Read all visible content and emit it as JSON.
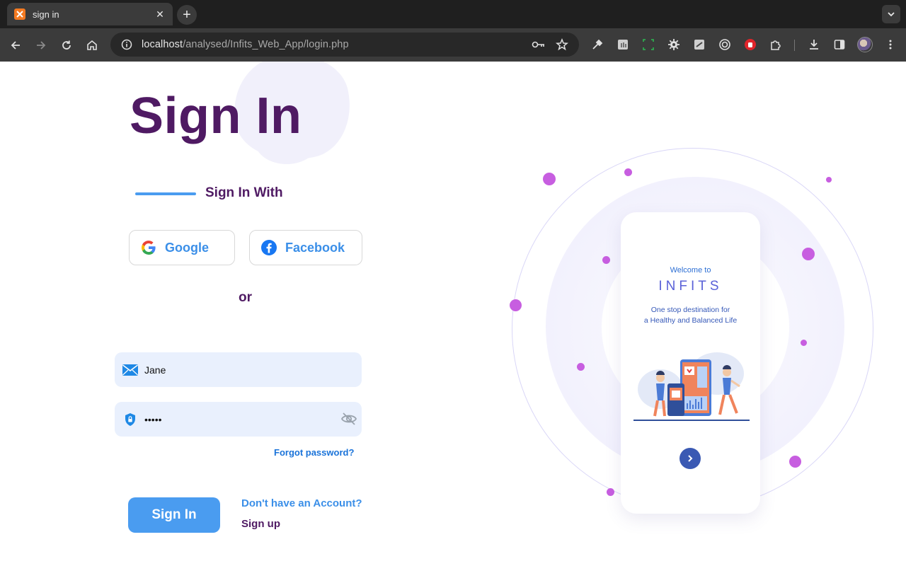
{
  "browser": {
    "tab_title": "sign in",
    "url_host": "localhost",
    "url_path": "/analysed/Infits_Web_App/login.php"
  },
  "login": {
    "title": "Sign In",
    "sign_in_with": "Sign In With",
    "google_label": "Google",
    "facebook_label": "Facebook",
    "or_label": "or",
    "email_value": "Jane",
    "password_value": "•••••",
    "forgot_label": "Forgot password?",
    "signin_button": "Sign In",
    "no_account": "Don't have an Account?",
    "signup_link": "Sign up"
  },
  "promo": {
    "welcome": "Welcome to",
    "brand": "INFITS",
    "tagline_line1": "One stop destination for",
    "tagline_line2": "a Healthy and Balanced Life"
  },
  "colors": {
    "title": "#4f1a63",
    "accent_blue": "#4a9cf0",
    "dot_purple": "#c75ee0"
  }
}
